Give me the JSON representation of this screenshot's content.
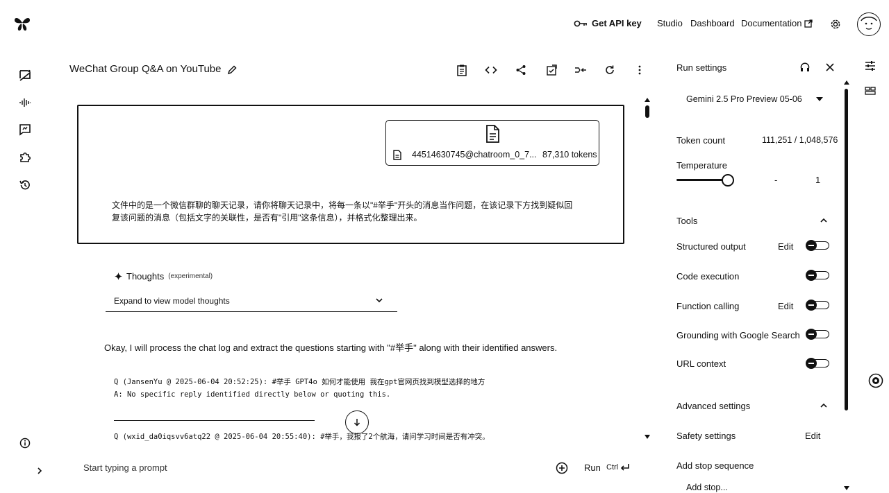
{
  "topbar": {
    "api_key_label": "Get API key",
    "studio_label": "Studio",
    "dashboard_label": "Dashboard",
    "documentation_label": "Documentation"
  },
  "chat": {
    "title": "WeChat Group Q&A on YouTube",
    "file": {
      "name": "44514630745@chatroom_0_7...",
      "tokens": "87,310 tokens"
    },
    "prompt_line1": "文件中的是一个微信群聊的聊天记录，请你将聊天记录中，将每一条以\"#举手\"开头的消息当作问题，在该记录下方找到疑似回",
    "prompt_line2": "复该问题的消息（包括文字的关联性，是否有\"引用\"这条信息），并格式化整理出来。",
    "thoughts_title": "Thoughts",
    "thoughts_tag": "(experimental)",
    "thoughts_expand": "Expand to view model thoughts",
    "response_intro": "Okay, I will process the chat log and extract the questions starting with \"#举手\" along with their identified answers.",
    "q1": "Q (JansenYu @ 2025-06-04 20:52:25): #举手 GPT4o 如何才能使用 我在gpt官网页找到模型选择的地方",
    "a1": "A: No specific reply identified directly below or quoting this.",
    "q2": "Q (wxid_da0iqsvv6atq22 @ 2025-06-04 20:55:40): #举手，我报了2个航海，请问学习时间是否有冲突。"
  },
  "input": {
    "placeholder": "Start typing a prompt",
    "run_label": "Run",
    "shortcut": "Ctrl"
  },
  "run_settings": {
    "title": "Run settings",
    "model": "Gemini 2.5 Pro Preview 05-06",
    "token_count_label": "Token count",
    "token_count_value": "111,251 / 1,048,576",
    "temperature_label": "Temperature",
    "temperature_dash": "-",
    "temperature_value": "1",
    "tools_label": "Tools",
    "tools": [
      {
        "label": "Structured output",
        "edit": "Edit",
        "enabled": false
      },
      {
        "label": "Code execution",
        "edit": "",
        "enabled": false
      },
      {
        "label": "Function calling",
        "edit": "Edit",
        "enabled": false
      },
      {
        "label": "Grounding with Google Search",
        "edit": "",
        "enabled": false
      },
      {
        "label": "URL context",
        "edit": "",
        "enabled": false
      }
    ],
    "advanced_label": "Advanced settings",
    "safety_label": "Safety settings",
    "safety_edit": "Edit",
    "stop_sequence_label": "Add stop sequence",
    "stop_placeholder": "Add stop..."
  }
}
